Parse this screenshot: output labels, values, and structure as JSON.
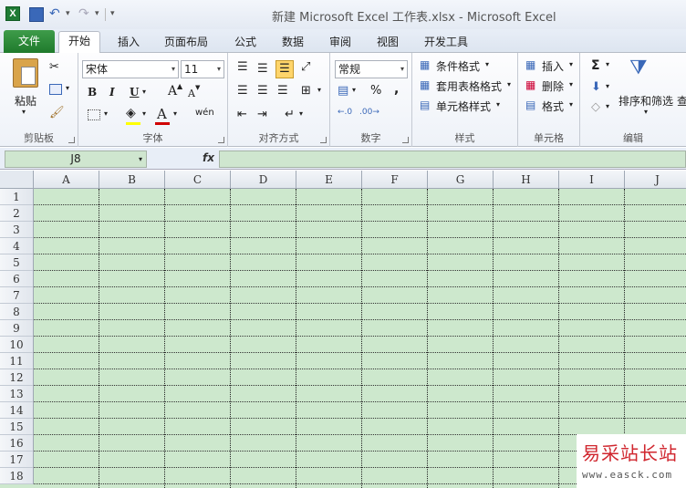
{
  "window": {
    "title": "新建 Microsoft Excel 工作表.xlsx  -  Microsoft Excel",
    "app_icon_letter": "X"
  },
  "tabs": [
    "开始",
    "插入",
    "页面布局",
    "公式",
    "数据",
    "审阅",
    "视图",
    "开发工具"
  ],
  "file_tab": "文件",
  "active_tab": "开始",
  "ribbon": {
    "clipboard": {
      "label": "剪贴板",
      "paste": "粘贴"
    },
    "font": {
      "label": "字体",
      "font_name": "宋体",
      "font_size": "11",
      "bold": "B",
      "italic": "I",
      "underline": "U",
      "grow": "A",
      "shrink": "A",
      "font_color_letter": "A",
      "phonetic": "wén"
    },
    "alignment": {
      "label": "对齐方式"
    },
    "number": {
      "label": "数字",
      "format": "常规",
      "percent": "%",
      "comma": ","
    },
    "styles": {
      "label": "样式",
      "conditional": "条件格式",
      "table": "套用表格格式",
      "cell_styles": "单元格样式"
    },
    "cells": {
      "label": "单元格",
      "insert": "插入",
      "delete": "删除",
      "format": "格式"
    },
    "editing": {
      "label": "编辑",
      "sort_filter": "排序和筛选",
      "find": "查",
      "sigma": "Σ"
    }
  },
  "formula_bar": {
    "name_box": "J8",
    "fx": "fx",
    "value": ""
  },
  "sheet": {
    "columns": [
      "A",
      "B",
      "C",
      "D",
      "E",
      "F",
      "G",
      "H",
      "I",
      "J"
    ],
    "rows": [
      "1",
      "2",
      "3",
      "4",
      "5",
      "6",
      "7",
      "8",
      "9",
      "10",
      "11",
      "12",
      "13",
      "14",
      "15",
      "16",
      "17",
      "18"
    ]
  },
  "watermark": {
    "text": "易采站长站",
    "url": "www.easck.com"
  },
  "colors": {
    "file_tab": "#1f7a2c",
    "sheet_bg": "#cde8cd",
    "watermark_red": "#d0262e"
  }
}
